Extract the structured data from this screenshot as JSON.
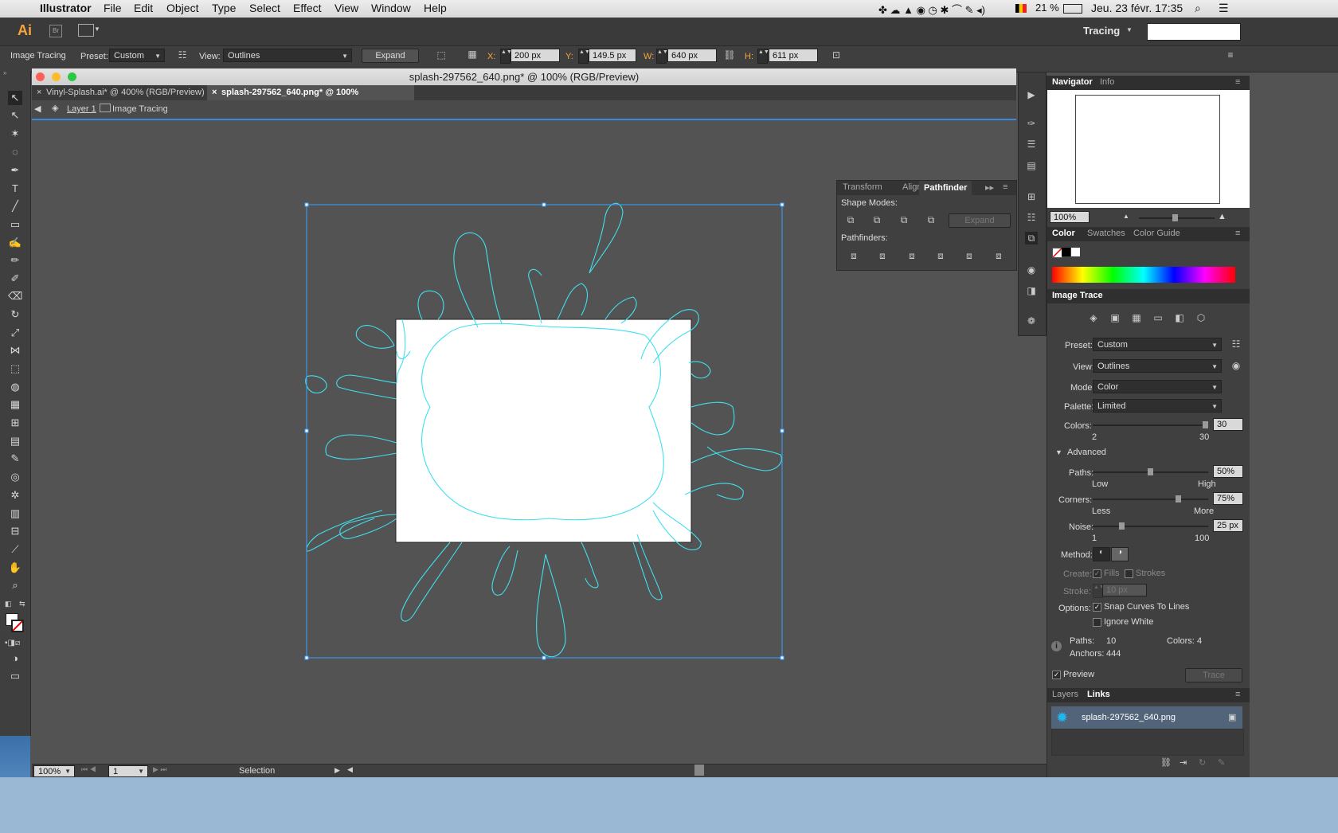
{
  "menubar": {
    "app": "Illustrator",
    "items": [
      "File",
      "Edit",
      "Object",
      "Type",
      "Select",
      "Effect",
      "View",
      "Window",
      "Help"
    ],
    "battery": "21 %",
    "clock": "Jeu. 23 févr.  17:35"
  },
  "appbar": {
    "logo": "Ai",
    "bridge": "Br",
    "workspace": "Tracing"
  },
  "control": {
    "mode_label": "Image Tracing",
    "preset_label": "Preset:",
    "preset": "Custom",
    "view_label": "View:",
    "view": "Outlines",
    "expand": "Expand",
    "x_label": "X:",
    "x": "200 px",
    "y_label": "Y:",
    "y": "149.5 px",
    "w_label": "W:",
    "w": "640 px",
    "h_label": "H:",
    "h": "611 px"
  },
  "document": {
    "title": "splash-297562_640.png* @ 100% (RGB/Preview)",
    "tabs": [
      "Vinyl-Splash.ai* @ 400% (RGB/Preview)",
      "splash-297562_640.png* @ 100% (RGB/Preview)"
    ],
    "breadcrumb_layer": "Layer 1",
    "breadcrumb_obj": "Image Tracing"
  },
  "status": {
    "zoom": "100%",
    "page": "1",
    "tool": "Selection"
  },
  "pathfinder": {
    "tabs": [
      "Transform",
      "Align",
      "Pathfinder"
    ],
    "shape_modes": "Shape Modes:",
    "expand": "Expand",
    "pathfinders": "Pathfinders:"
  },
  "navigator": {
    "tabs": [
      "Navigator",
      "Info"
    ],
    "zoom": "100%"
  },
  "color": {
    "tabs": [
      "Color",
      "Swatches",
      "Color Guide"
    ]
  },
  "trace": {
    "title": "Image Trace",
    "preset_label": "Preset:",
    "preset": "Custom",
    "view_label": "View:",
    "view": "Outlines",
    "mode_label": "Mode:",
    "mode": "Color",
    "palette_label": "Palette:",
    "palette": "Limited",
    "colors_label": "Colors:",
    "colors": "30",
    "colors_min": "2",
    "colors_max": "30",
    "colors_frac": 1.0,
    "advanced": "Advanced",
    "paths_label": "Paths:",
    "paths": "50%",
    "paths_low": "Low",
    "paths_high": "High",
    "paths_frac": 0.5,
    "corners_label": "Corners:",
    "corners": "75%",
    "corners_less": "Less",
    "corners_more": "More",
    "corners_frac": 0.75,
    "noise_label": "Noise:",
    "noise": "25 px",
    "noise_min": "1",
    "noise_max": "100",
    "noise_frac": 0.24,
    "method_label": "Method:",
    "create_label": "Create:",
    "fills": "Fills",
    "strokes": "Strokes",
    "stroke_label": "Stroke:",
    "stroke": "10 px",
    "options_label": "Options:",
    "snap": "Snap Curves To Lines",
    "ignore": "Ignore White",
    "stat_paths_label": "Paths:",
    "stat_paths": "10",
    "stat_colors_label": "Colors:",
    "stat_colors": "4",
    "stat_anchors_label": "Anchors:",
    "stat_anchors": "444",
    "preview": "Preview",
    "trace_btn": "Trace"
  },
  "links": {
    "tabs": [
      "Layers",
      "Links"
    ],
    "file": "splash-297562_640.png"
  },
  "colors": {
    "accent": "#3c8ae0",
    "trace_outline": "#3fe0ee",
    "selection": "#3aa0ff"
  }
}
